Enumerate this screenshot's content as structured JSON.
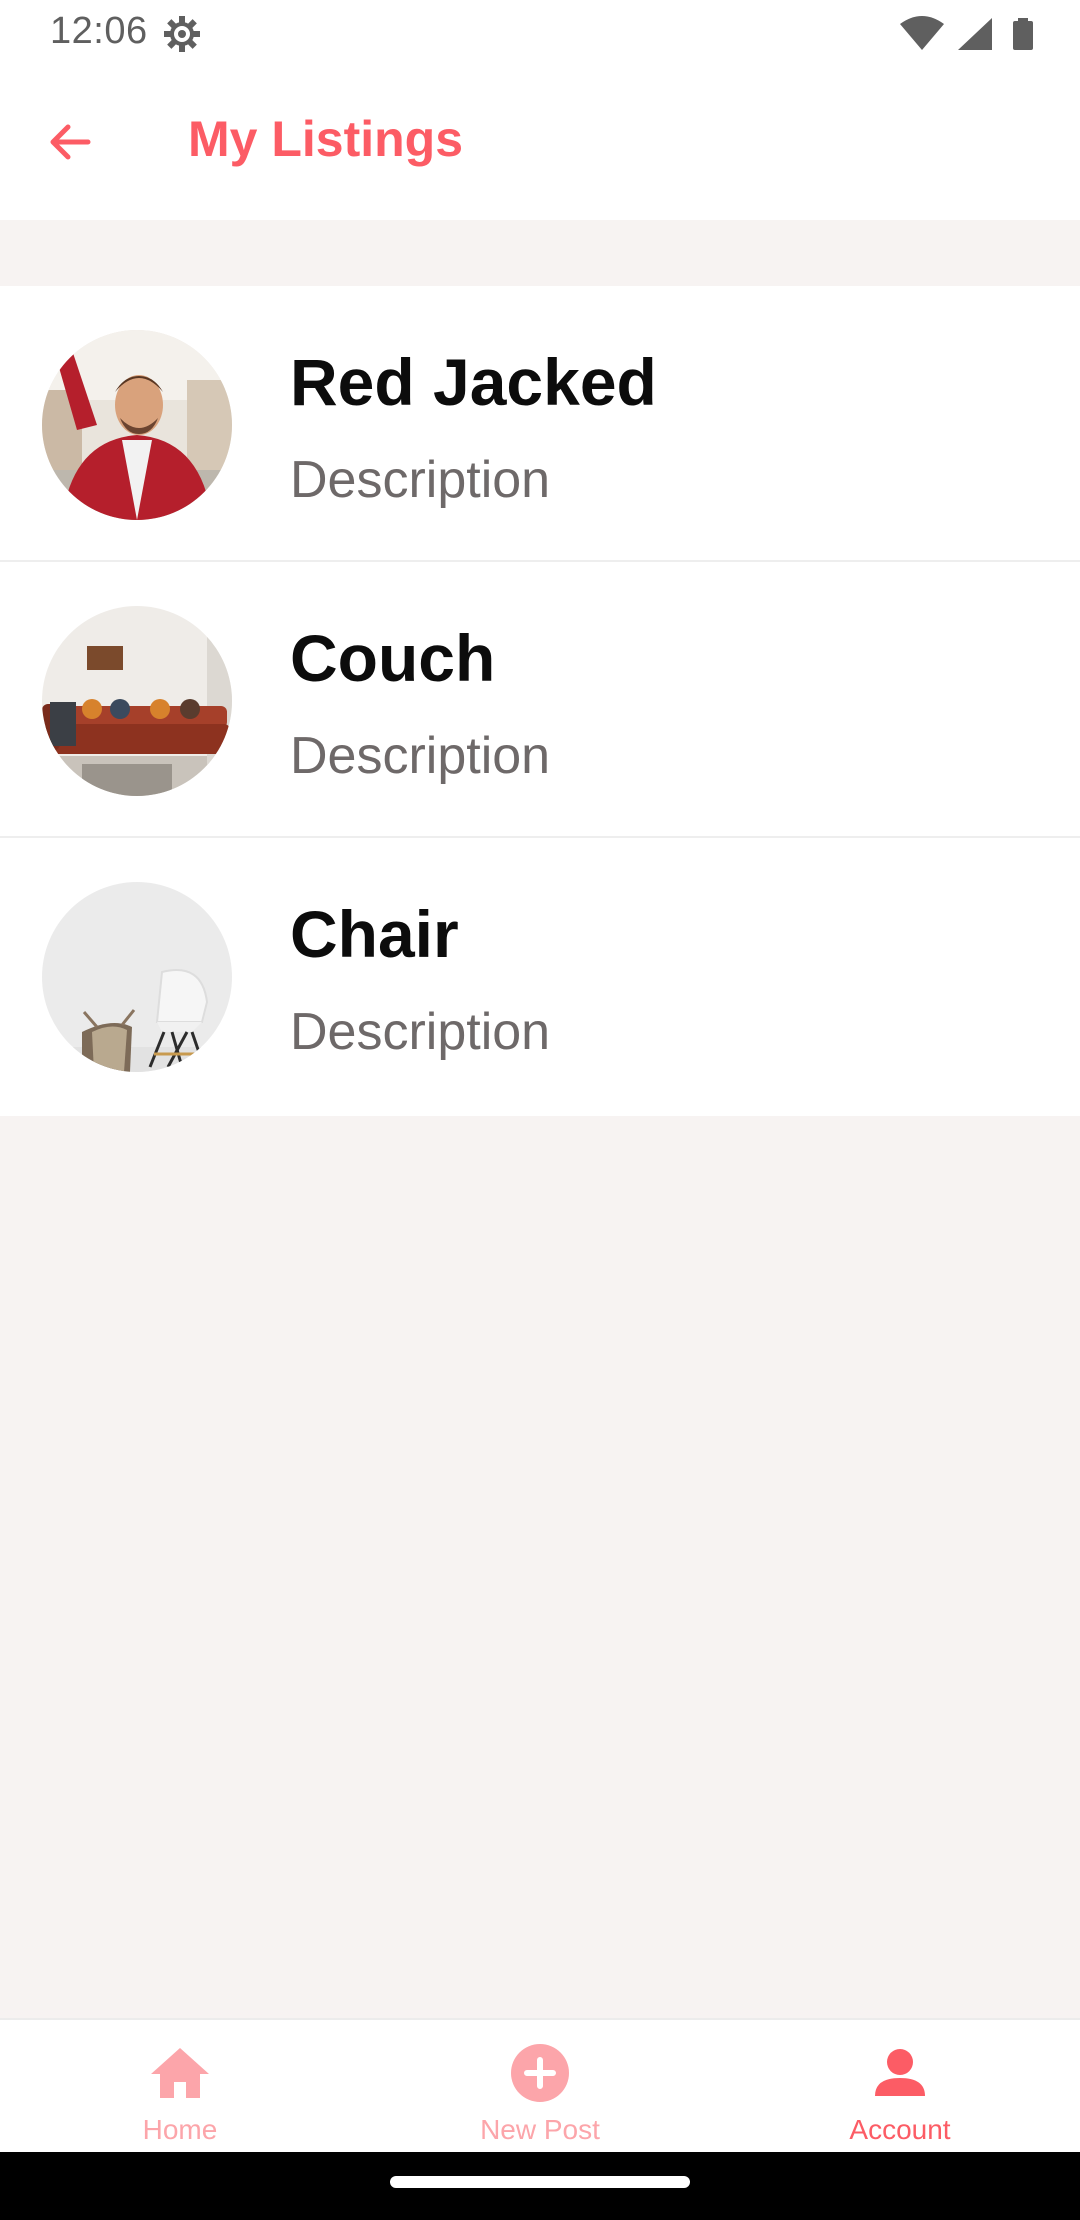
{
  "status_bar": {
    "time": "12:06"
  },
  "app_bar": {
    "title": "My Listings"
  },
  "listings": [
    {
      "title": "Red Jacked",
      "subtitle": "Description",
      "thumb": "person-photo"
    },
    {
      "title": "Couch",
      "subtitle": "Description",
      "thumb": "couch-photo"
    },
    {
      "title": "Chair",
      "subtitle": "Description",
      "thumb": "chair-photo"
    }
  ],
  "tabs": {
    "home": {
      "label": "Home",
      "icon": "home-icon"
    },
    "new_post": {
      "label": "New Post",
      "icon": "plus-circle-icon"
    },
    "account": {
      "label": "Account",
      "icon": "account-icon",
      "active": true
    }
  },
  "colors": {
    "accent": "#fc5c65",
    "accent_inactive": "#fca5aa",
    "background": "#f7f3f2",
    "title_text": "#0c0c0c",
    "subtitle_text": "#6e6969"
  }
}
